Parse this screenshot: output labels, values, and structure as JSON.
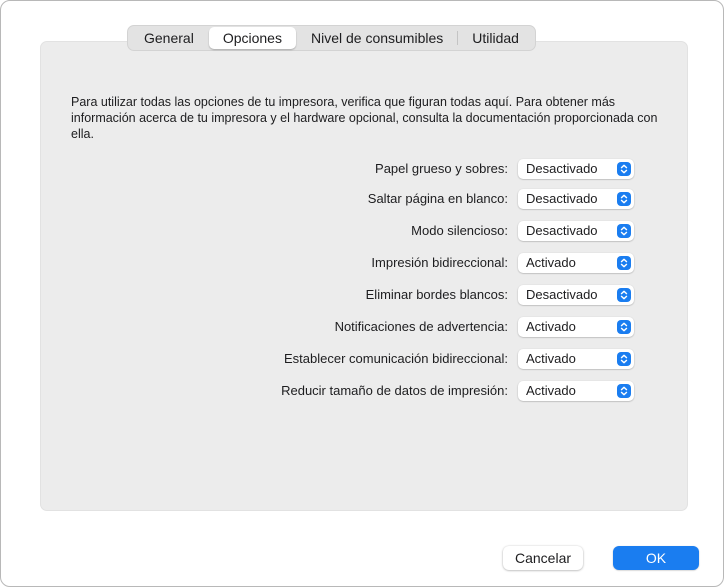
{
  "tabs": [
    {
      "label": "General",
      "selected": false
    },
    {
      "label": "Opciones",
      "selected": true
    },
    {
      "label": "Nivel de consumibles",
      "selected": false
    },
    {
      "label": "Utilidad",
      "selected": false
    }
  ],
  "intro_text": "Para utilizar todas las opciones de tu impresora, verifica que figuran todas aquí. Para obtener más información acerca de tu impresora y el hardware opcional, consulta la documentación proporcionada con ella.",
  "options": [
    {
      "label": "Papel grueso y sobres:",
      "value": "Desactivado"
    },
    {
      "label": "Saltar página en blanco:",
      "value": "Desactivado"
    },
    {
      "label": "Modo silencioso:",
      "value": "Desactivado"
    },
    {
      "label": "Impresión bidireccional:",
      "value": "Activado"
    },
    {
      "label": "Eliminar bordes blancos:",
      "value": "Desactivado"
    },
    {
      "label": "Notificaciones de advertencia:",
      "value": "Activado"
    },
    {
      "label": "Establecer comunicación bidireccional:",
      "value": "Activado"
    },
    {
      "label": "Reducir tamaño de datos de impresión:",
      "value": "Activado"
    }
  ],
  "buttons": {
    "cancel": "Cancelar",
    "ok": "OK"
  },
  "colors": {
    "accent": "#1a7df0",
    "panel": "#ececec"
  },
  "icons": {
    "popup_indicator": "up-down-chevron-icon"
  }
}
